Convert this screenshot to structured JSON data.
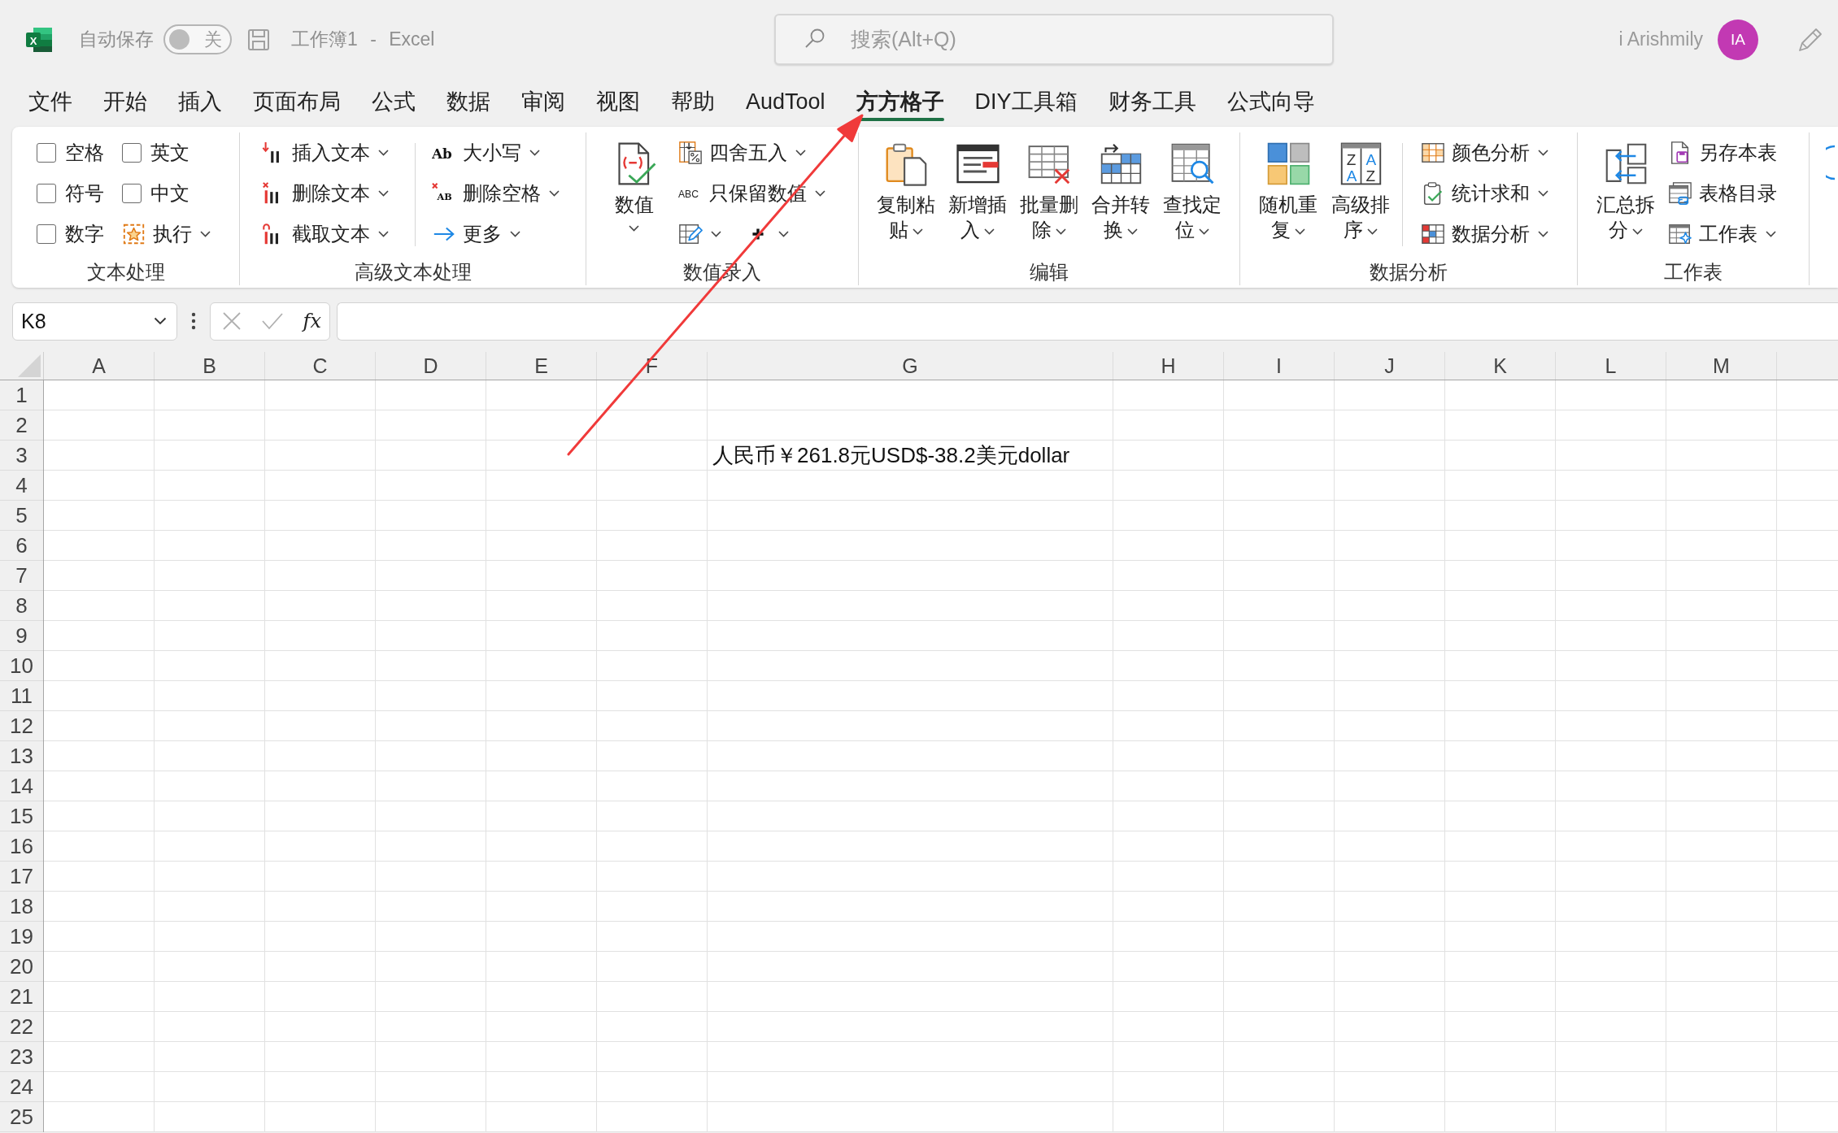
{
  "title_bar": {
    "logo_letter": "X",
    "autosave_label": "自动保存",
    "autosave": {
      "on": false,
      "label": "关"
    },
    "document_title": "工作簿1 - Excel",
    "search": {
      "placeholder": "搜索(Alt+Q)"
    },
    "user": {
      "name": "i Arishmily",
      "initials": "IA"
    }
  },
  "menu_tabs": [
    {
      "label": "文件",
      "selected": false
    },
    {
      "label": "开始",
      "selected": false
    },
    {
      "label": "插入",
      "selected": false
    },
    {
      "label": "页面布局",
      "selected": false
    },
    {
      "label": "公式",
      "selected": false
    },
    {
      "label": "数据",
      "selected": false
    },
    {
      "label": "审阅",
      "selected": false
    },
    {
      "label": "视图",
      "selected": false
    },
    {
      "label": "帮助",
      "selected": false
    },
    {
      "label": "AudTool",
      "selected": false
    },
    {
      "label": "方方格子",
      "selected": true
    },
    {
      "label": "DIY工具箱",
      "selected": false
    },
    {
      "label": "财务工具",
      "selected": false
    },
    {
      "label": "公式向导",
      "selected": false
    }
  ],
  "ribbon": {
    "groups": [
      {
        "label": "文本处理",
        "sections": [
          {
            "kind": "grid",
            "items": [
              {
                "kind": "checkbox",
                "label": "空格",
                "checked": false
              },
              {
                "kind": "checkbox",
                "label": "英文",
                "checked": false
              },
              {
                "kind": "checkbox",
                "label": "符号",
                "checked": false
              },
              {
                "kind": "checkbox",
                "label": "中文",
                "checked": false
              },
              {
                "kind": "checkbox",
                "label": "数字",
                "checked": false
              },
              {
                "kind": "button",
                "label": "执行",
                "dropdown": true
              }
            ]
          }
        ]
      },
      {
        "label": "高级文本处理",
        "sections": [
          {
            "kind": "stack",
            "items": [
              {
                "kind": "button",
                "label": "插入文本",
                "dropdown": true
              },
              {
                "kind": "button",
                "label": "删除文本",
                "dropdown": true
              },
              {
                "kind": "button",
                "label": "截取文本",
                "dropdown": true
              }
            ]
          },
          {
            "kind": "divider"
          },
          {
            "kind": "stack",
            "items": [
              {
                "kind": "button",
                "label": "大小写",
                "icon_text": "Ab",
                "dropdown": true
              },
              {
                "kind": "button",
                "label": "删除空格",
                "icon_text": "AB",
                "dropdown": true
              },
              {
                "kind": "button",
                "label": "更多",
                "dropdown": true
              }
            ]
          }
        ]
      },
      {
        "label": "数值录入",
        "sections": [
          {
            "kind": "large",
            "label": "数值",
            "dropdown": true
          },
          {
            "kind": "stack",
            "items": [
              {
                "kind": "button",
                "label": "四舍五入",
                "dropdown": true
              },
              {
                "kind": "button",
                "label": "只保留数值",
                "icon_text": "ABC",
                "dropdown": true
              },
              {
                "kind": "icon_row",
                "buttons": [
                  {
                    "dropdown": true
                  },
                  {
                    "dropdown": true
                  }
                ]
              }
            ]
          }
        ]
      },
      {
        "label": "编辑",
        "sections": [
          {
            "kind": "large",
            "label": "复制粘贴",
            "dropdown": true
          },
          {
            "kind": "large",
            "label": "新增插入",
            "dropdown": true
          },
          {
            "kind": "large",
            "label": "批量删除",
            "dropdown": true
          },
          {
            "kind": "large",
            "label": "合并转换",
            "dropdown": true
          },
          {
            "kind": "large",
            "label": "查找定位",
            "dropdown": true
          }
        ]
      },
      {
        "label": "数据分析",
        "sections": [
          {
            "kind": "large",
            "label": "随机重复",
            "dropdown": true
          },
          {
            "kind": "large",
            "label": "高级排序",
            "icon_text": [
              "Z",
              "A",
              "A",
              "Z"
            ],
            "dropdown": true
          },
          {
            "kind": "divider"
          },
          {
            "kind": "stack",
            "items": [
              {
                "kind": "button",
                "label": "颜色分析",
                "dropdown": true
              },
              {
                "kind": "button",
                "label": "统计求和",
                "dropdown": true
              },
              {
                "kind": "button",
                "label": "数据分析",
                "dropdown": true
              }
            ]
          }
        ]
      },
      {
        "label": "工作表",
        "sections": [
          {
            "kind": "large",
            "label": "汇总拆分",
            "dropdown": true
          },
          {
            "kind": "stack",
            "items": [
              {
                "kind": "button",
                "label": "另存本表",
                "dropdown": false
              },
              {
                "kind": "button",
                "label": "表格目录",
                "dropdown": false
              },
              {
                "kind": "button",
                "label": "工作表",
                "dropdown": true
              }
            ]
          }
        ]
      }
    ]
  },
  "formula_bar": {
    "name_box": "K8",
    "function_label": "fx"
  },
  "sheet": {
    "columns": [
      {
        "label": "A",
        "wide": false
      },
      {
        "label": "B",
        "wide": false
      },
      {
        "label": "C",
        "wide": false
      },
      {
        "label": "D",
        "wide": false
      },
      {
        "label": "E",
        "wide": false
      },
      {
        "label": "F",
        "wide": false
      },
      {
        "label": "G",
        "wide": true
      },
      {
        "label": "H",
        "wide": false
      },
      {
        "label": "I",
        "wide": false
      },
      {
        "label": "J",
        "wide": false
      },
      {
        "label": "K",
        "wide": false
      },
      {
        "label": "L",
        "wide": false
      },
      {
        "label": "M",
        "wide": false
      }
    ],
    "rows": [
      {
        "label": "1"
      },
      {
        "label": "2"
      },
      {
        "label": "3",
        "cells": [
          {},
          {},
          {},
          {},
          {},
          {},
          {
            "text": "人民币￥261.8元USD$-38.2美元dollar"
          }
        ]
      },
      {
        "label": "4"
      },
      {
        "label": "5"
      },
      {
        "label": "6"
      },
      {
        "label": "7"
      },
      {
        "label": "8"
      },
      {
        "label": "9"
      },
      {
        "label": "10"
      },
      {
        "label": "11"
      },
      {
        "label": "12"
      },
      {
        "label": "13"
      },
      {
        "label": "14"
      },
      {
        "label": "15"
      },
      {
        "label": "16"
      },
      {
        "label": "17"
      },
      {
        "label": "18"
      },
      {
        "label": "19"
      },
      {
        "label": "20"
      },
      {
        "label": "21"
      },
      {
        "label": "22"
      },
      {
        "label": "23"
      },
      {
        "label": "24"
      },
      {
        "label": "25"
      }
    ]
  }
}
